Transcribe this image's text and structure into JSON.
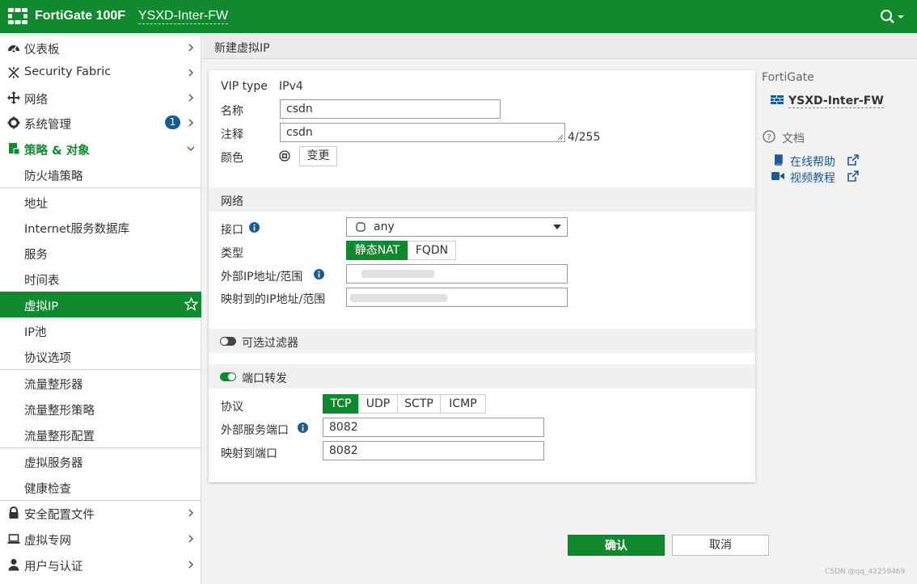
{
  "topbar": {
    "product": "FortiGate 100F",
    "hostname": "YSXD-Inter-FW",
    "search_icon": "search-icon"
  },
  "sidebar": {
    "dashboard": "仪表板",
    "security_fabric": "Security Fabric",
    "network": "网络",
    "system": "系统管理",
    "system_badge": "1",
    "policy_objects": "策略 & 对象",
    "firewall_policy": "防火墙策略",
    "addresses": "地址",
    "isdb": "Internet服务数据库",
    "services": "服务",
    "schedules": "时间表",
    "virtual_ip": "虚拟IP",
    "ip_pool": "IP池",
    "protocol_options": "协议选项",
    "traffic_shapers": "流量整形器",
    "traffic_shaping_policy": "流量整形策略",
    "traffic_shaping_profile": "流量整形配置",
    "virtual_servers": "虚拟服务器",
    "health_check": "健康检查",
    "security_profiles": "安全配置文件",
    "vpn": "虚拟专网",
    "user_auth": "用户与认证"
  },
  "page": {
    "title": "新建虚拟IP"
  },
  "form": {
    "vip_type_label": "VIP type",
    "vip_type_value": "IPv4",
    "name_label": "名称",
    "name_value": "csdn",
    "comment_label": "注释",
    "comment_value": "csdn",
    "comment_counter": "4/255",
    "color_label": "颜色",
    "color_change": "变更",
    "network_section": "网络",
    "interface_label": "接口",
    "interface_value": "any",
    "type_label": "类型",
    "type_static_nat": "静态NAT",
    "type_fqdn": "FQDN",
    "ext_ip_label": "外部IP地址/范围",
    "mapped_ip_label": "映射到的IP地址/范围",
    "optional_filters": "可选过滤器",
    "port_forwarding": "端口转发",
    "protocol_label": "协议",
    "protocols": [
      "TCP",
      "UDP",
      "SCTP",
      "ICMP"
    ],
    "ext_port_label": "外部服务端口",
    "ext_port_value": "8082",
    "mapped_port_label": "映射到端口",
    "mapped_port_value": "8082"
  },
  "right_panel": {
    "title": "FortiGate",
    "device": "YSXD-Inter-FW",
    "docs": "文档",
    "online_help": "在线帮助",
    "video_tutorials": "视频教程"
  },
  "buttons": {
    "ok": "确认",
    "cancel": "取消"
  },
  "watermark": "CSDN @qq_42259469",
  "colors": {
    "brand_green": "#118a2f",
    "badge_blue": "#1c5b8f"
  }
}
